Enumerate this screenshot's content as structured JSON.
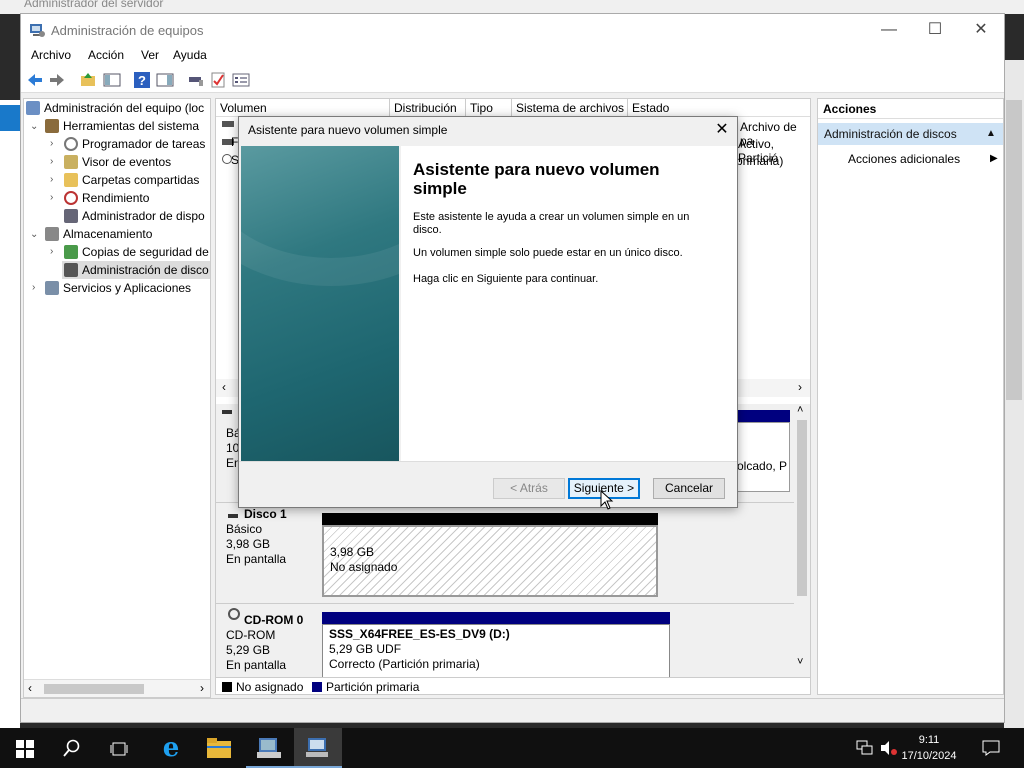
{
  "background": {
    "window_title": "Administrador del servidor"
  },
  "window": {
    "title": "Administración de equipos",
    "minimize": "—",
    "maximize": "☐",
    "close": "✕"
  },
  "menu": [
    "Archivo",
    "Acción",
    "Ver",
    "Ayuda"
  ],
  "tree": {
    "root": "Administración del equipo (loc",
    "system_tools": "Herramientas del sistema",
    "task_scheduler": "Programador de tareas",
    "event_viewer": "Visor de eventos",
    "shared_folders": "Carpetas compartidas",
    "performance": "Rendimiento",
    "device_manager": "Administrador de dispo",
    "storage": "Almacenamiento",
    "backup": "Copias de seguridad de",
    "disk_mgmt": "Administración de disco",
    "services": "Servicios y Aplicaciones"
  },
  "volume_table": {
    "headers": [
      "Volumen",
      "Distribución",
      "Tipo",
      "Sistema de archivos",
      "Estado"
    ],
    "status_fragments": [
      "Archivo de pa",
      "Activo, Partició",
      "primaria)"
    ],
    "row_prefixes": [
      "",
      "F",
      "S"
    ]
  },
  "disks": {
    "disk0_fragments": {
      "type": "Bás",
      "size": "100",
      "status": "En",
      "part_text": "olcado, P"
    },
    "disk1": {
      "name": "Disco 1",
      "type": "Básico",
      "size": "3,98 GB",
      "status": "En pantalla",
      "partition": {
        "size": "3,98 GB",
        "label": "No asignado"
      }
    },
    "cdrom0": {
      "name": "CD-ROM 0",
      "type": "CD-ROM",
      "size": "5,29 GB",
      "status": "En pantalla",
      "partition": {
        "label": "SSS_X64FREE_ES-ES_DV9  (D:)",
        "size": "5,29 GB UDF",
        "status": "Correcto (Partición primaria)"
      }
    }
  },
  "legend": {
    "unallocated": "No asignado",
    "primary": "Partición primaria"
  },
  "actions": {
    "header": "Acciones",
    "selected": "Administración de discos",
    "more": "Acciones adicionales"
  },
  "wizard": {
    "title": "Asistente para nuevo volumen simple",
    "heading": "Asistente para nuevo volumen simple",
    "p1": "Este asistente le ayuda a crear un volumen simple en un disco.",
    "p2": "Un volumen simple solo puede estar en un único disco.",
    "p3": "Haga clic en Siguiente para continuar.",
    "back": "< Atrás",
    "next": "Siguiente >",
    "cancel": "Cancelar"
  },
  "taskbar": {
    "time": "9:11",
    "date": "17/10/2024"
  },
  "colors": {
    "accent_blue": "#1979ca",
    "primary_partition": "#00007f",
    "unallocated": "#000000",
    "selection": "#cfe3f5"
  }
}
